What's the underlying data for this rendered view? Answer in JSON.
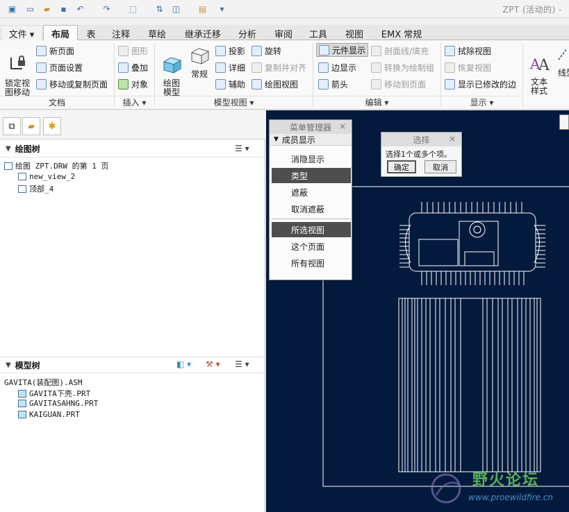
{
  "window": {
    "title": "ZPT (活动的) -"
  },
  "tabs": [
    "文件 ▾",
    "布局",
    "表",
    "注释",
    "草绘",
    "继承迁移",
    "分析",
    "审阅",
    "工具",
    "视图",
    "EMX 常规"
  ],
  "ribbon": {
    "doc": {
      "lock_view": "锁定视\n图移动",
      "new_page": "新页面",
      "page_setup": "页面设置",
      "move_copy_page": "移动或复制页面",
      "group": "文档"
    },
    "insert": {
      "graphic": "图形",
      "overlay": "叠加",
      "object": "对象",
      "group": "插入 ▾"
    },
    "model_view": {
      "drawing_model": "绘图\n模型",
      "general": "常规",
      "projection": "投影",
      "detail": "详细",
      "auxiliary": "辅助",
      "rotate": "旋转",
      "copy_align": "复制并对齐",
      "drawing_view": "绘图视图",
      "group": "模型视图 ▾"
    },
    "edit": {
      "component_display": "元件显示",
      "section_fill": "剖面线/填充",
      "edge_display": "边显示",
      "convert_group": "转换为绘制组",
      "arrow": "箭头",
      "move_to_page": "移动到页面",
      "group": "编辑 ▾"
    },
    "display": {
      "erase_view": "拭除视图",
      "resume_view": "恢复视图",
      "show_modified_edges": "显示已修改的边",
      "group": "显示 ▾"
    },
    "format": {
      "text_style": "文本\n样式",
      "line_style": "线型"
    }
  },
  "drawing_tree": {
    "header": "绘图树",
    "root": "绘图 ZPT.DRW 的第 1 页",
    "items": [
      "new_view_2",
      "顶部_4"
    ]
  },
  "model_tree": {
    "header": "模型树",
    "root": "GAVITA(装配图).ASM",
    "items": [
      "GAVITA下壳.PRT",
      "GAVITASAHNG.PRT",
      "KAIGUAN.PRT"
    ]
  },
  "menu_manager": {
    "title": "菜单管理器",
    "submenu": "成员显示",
    "items": [
      "消隐显示",
      "类型",
      "遮蔽",
      "取消遮蔽",
      "所选视图",
      "这个页面",
      "所有视图"
    ]
  },
  "select_dialog": {
    "title": "选择",
    "message": "选择1个或多个项。",
    "ok": "确定",
    "cancel": "取消"
  },
  "watermark": {
    "name": "野火论坛",
    "url": "www.proewildfire.cn"
  },
  "colors": {
    "canvas": "#041a3d",
    "drawing": "#ffffff",
    "highlight": "#4e4e4e"
  }
}
